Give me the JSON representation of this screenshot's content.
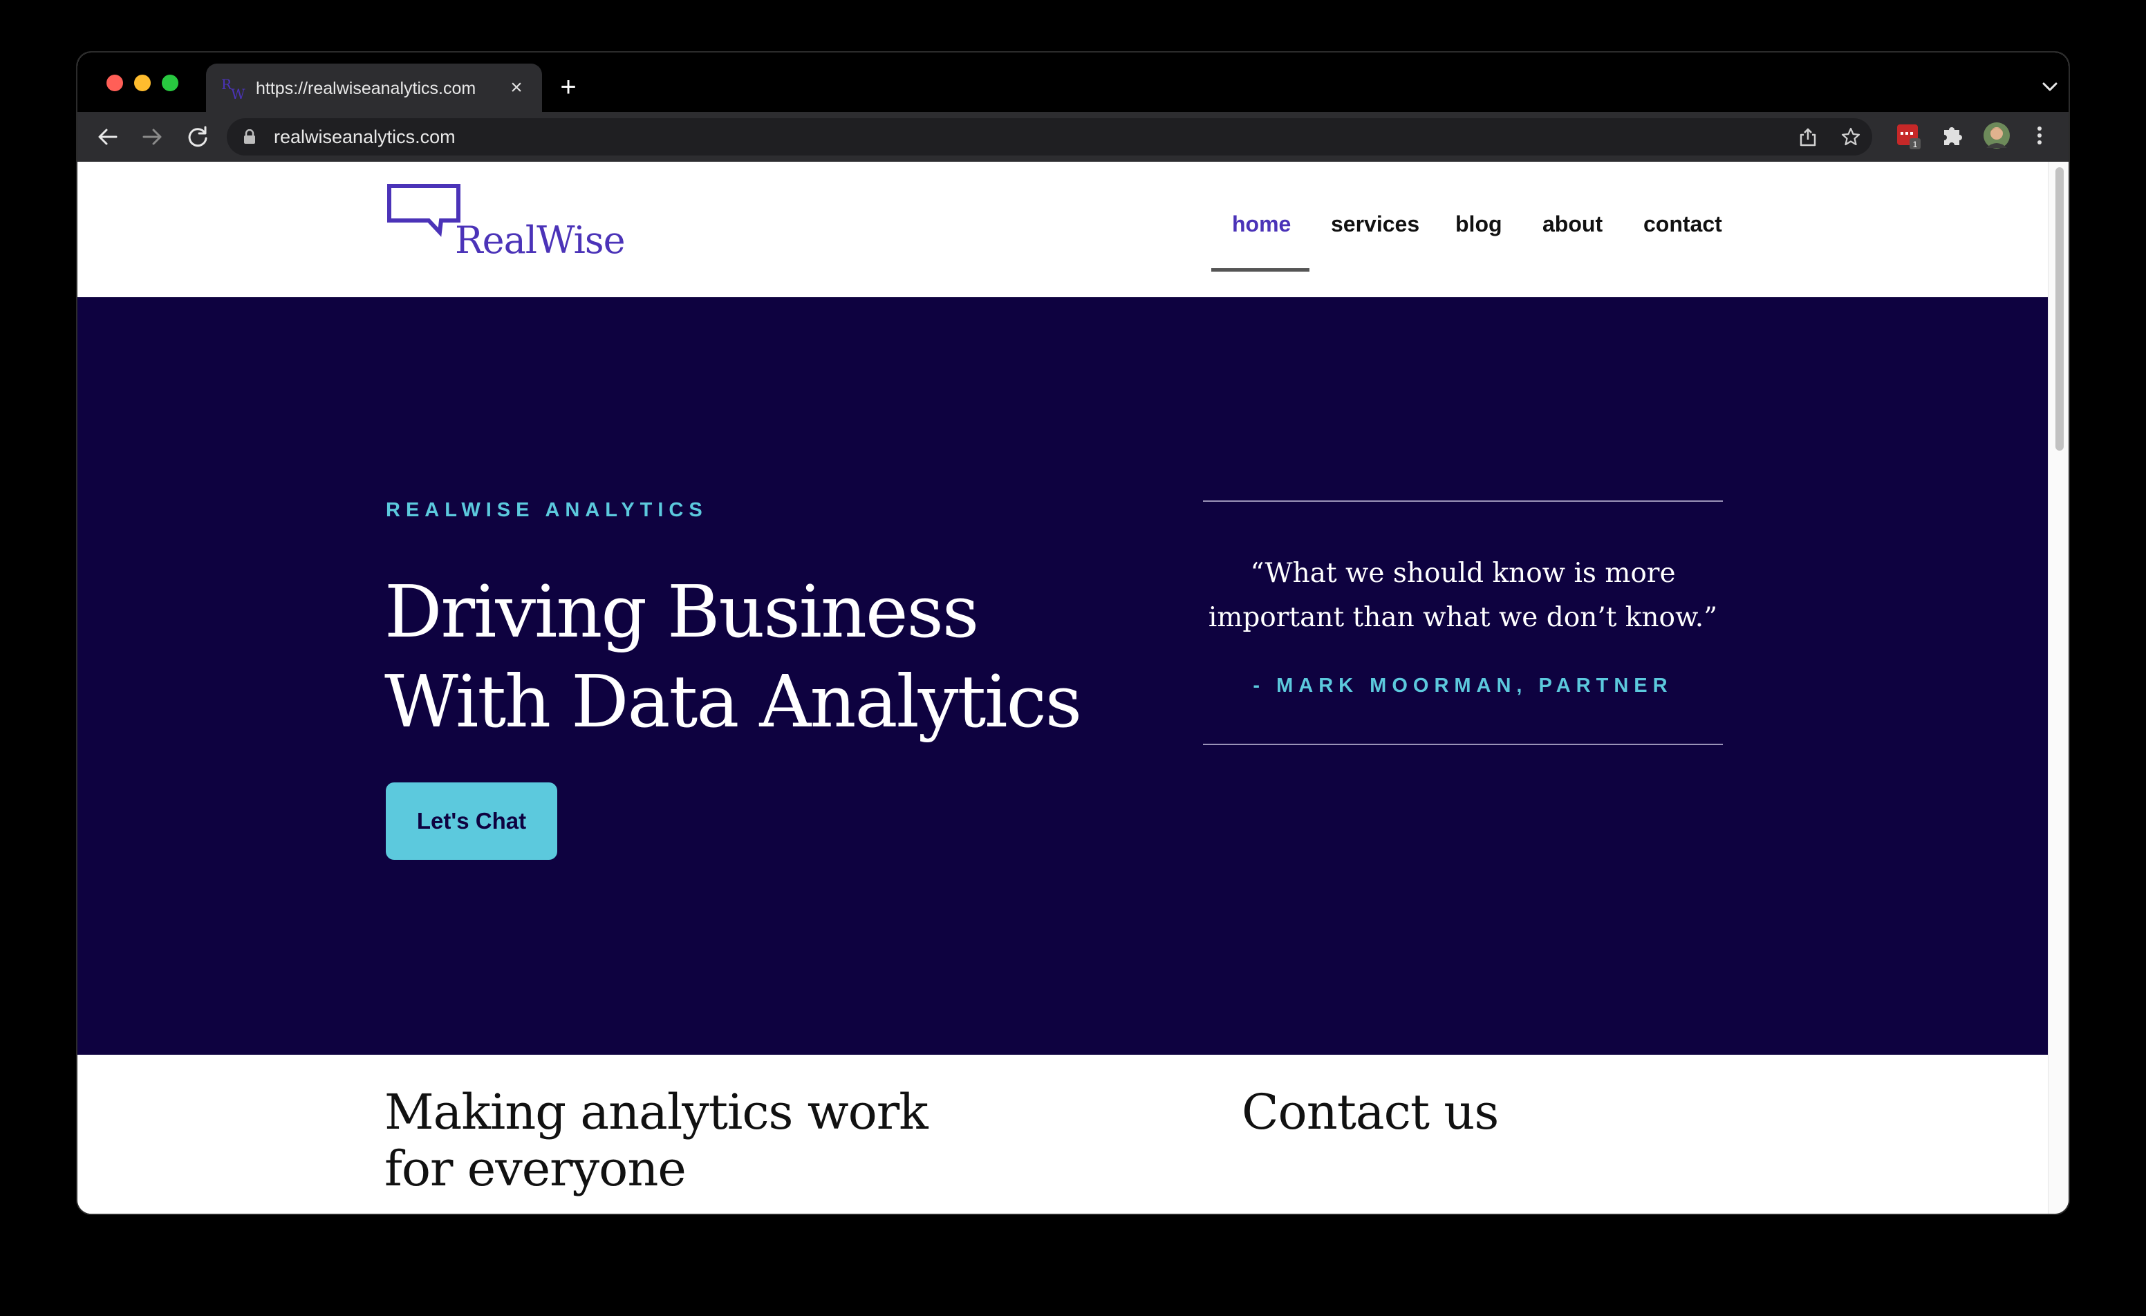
{
  "browser": {
    "tab": {
      "title": "https://realwiseanalytics.com",
      "favicon_letters": [
        "R",
        "W"
      ],
      "close": "×"
    },
    "new_tab": "+",
    "url": "realwiseanalytics.com",
    "extension_badge": "1"
  },
  "site": {
    "logo_text": "RealWise",
    "nav": [
      "home",
      "services",
      "blog",
      "about",
      "contact"
    ],
    "active_nav": "home"
  },
  "hero": {
    "eyebrow": "REALWISE ANALYTICS",
    "title_line1": "Driving Business",
    "title_line2": "With Data Analytics",
    "cta": "Let's Chat",
    "quote_line1": "“What we should know is more",
    "quote_line2": "important than what we don’t know.”",
    "quote_author": "- MARK MOORMAN, PARTNER"
  },
  "sections": {
    "left_heading": "Making analytics work for everyone",
    "right_heading": "Contact us"
  },
  "colors": {
    "brand_purple": "#4b33b8",
    "hero_background": "#0e0240",
    "accent_cyan": "#5cc9dd"
  }
}
